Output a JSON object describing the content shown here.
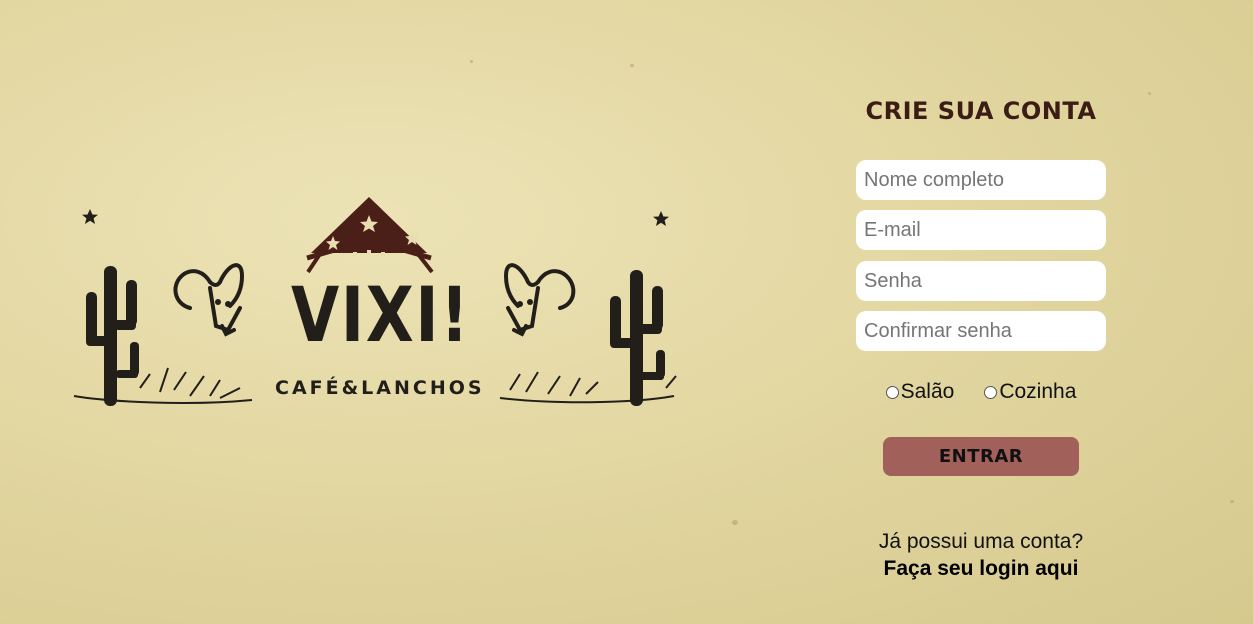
{
  "logo": {
    "title": "VIXI!",
    "subtitle": "CAFÉ&LANCHOS"
  },
  "form": {
    "title": "CRIE SUA CONTA",
    "fields": {
      "name_placeholder": "Nome completo",
      "email_placeholder": "E-mail",
      "password_placeholder": "Senha",
      "confirm_placeholder": "Confirmar senha"
    },
    "roles": [
      "Salão",
      "Cozinha"
    ],
    "submit_label": "ENTRAR",
    "login_question": "Já possui uma conta?",
    "login_link": "Faça seu login aqui"
  },
  "colors": {
    "background": "#e3d7a2",
    "title": "#3b1d16",
    "button": "#a2605a",
    "logo_ink": "#221f1a",
    "roof": "#4a1f17"
  }
}
